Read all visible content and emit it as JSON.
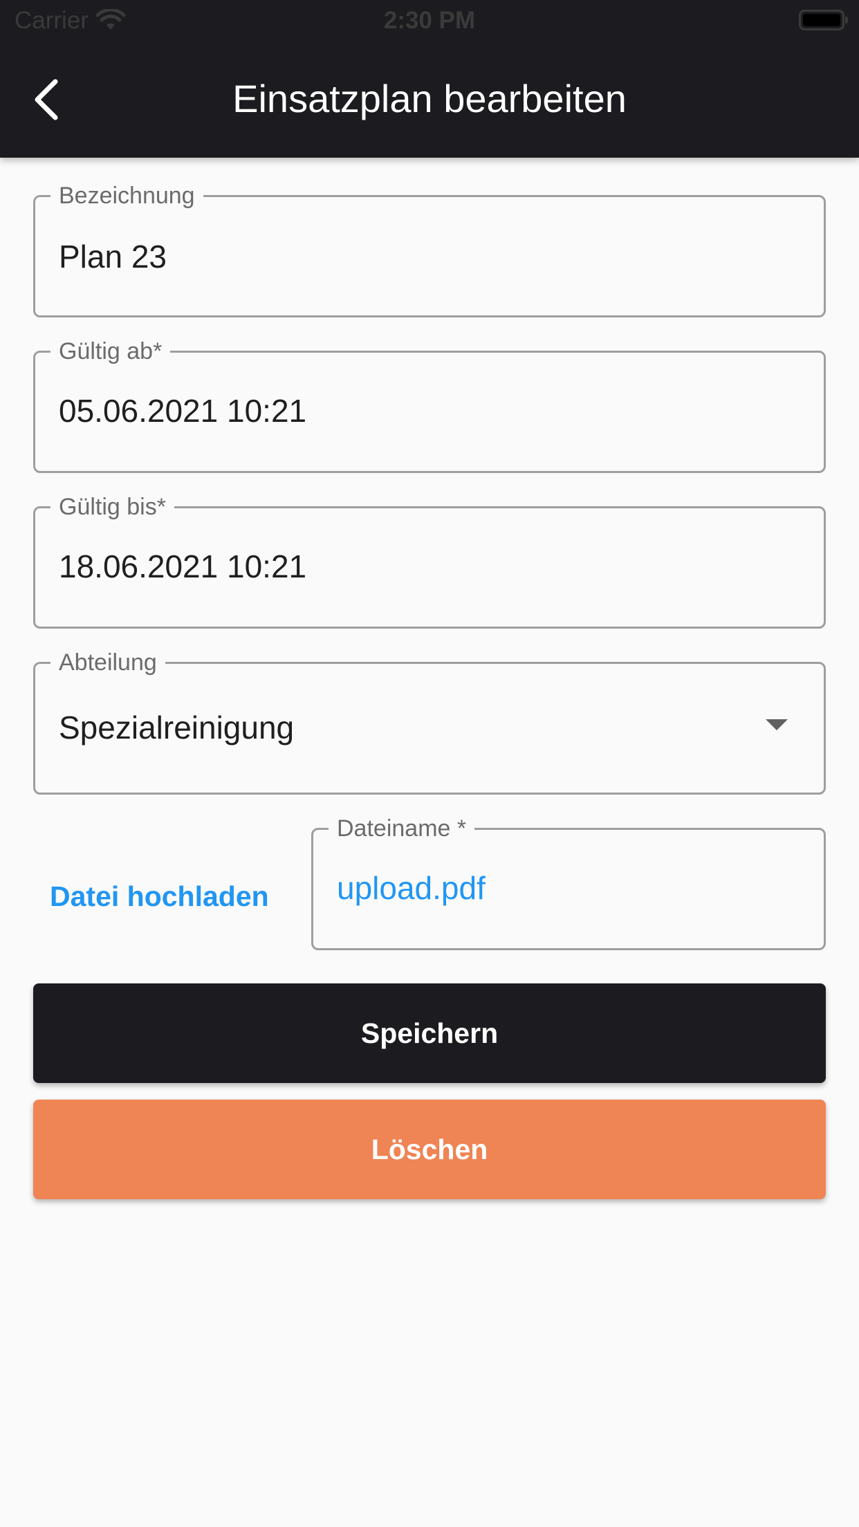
{
  "status_bar": {
    "carrier": "Carrier",
    "time": "2:30 PM",
    "wifi_icon": "wifi-icon",
    "battery_icon": "battery-icon"
  },
  "app_bar": {
    "back_icon": "chevron-left-icon",
    "title": "Einsatzplan bearbeiten",
    "background_color": "#1c1b1f"
  },
  "form": {
    "bezeichnung": {
      "label": "Bezeichnung",
      "value": "Plan 23"
    },
    "gueltig_ab": {
      "label": "Gültig ab*",
      "value": "05.06.2021 10:21"
    },
    "gueltig_bis": {
      "label": "Gültig bis*",
      "value": "18.06.2021 10:21"
    },
    "abteilung": {
      "label": "Abteilung",
      "value": "Spezialreinigung",
      "icon": "dropdown-arrow-icon"
    },
    "upload_link": "Datei hochladen",
    "dateiname": {
      "label": "Dateiname *",
      "value": "upload.pdf"
    }
  },
  "actions": {
    "save_label": "Speichern",
    "save_color": "#1c1b1f",
    "delete_label": "Löschen",
    "delete_color": "#ef8454"
  },
  "colors": {
    "link": "#2196f3",
    "background": "#fafafa",
    "outline": "#9e9e9e"
  }
}
